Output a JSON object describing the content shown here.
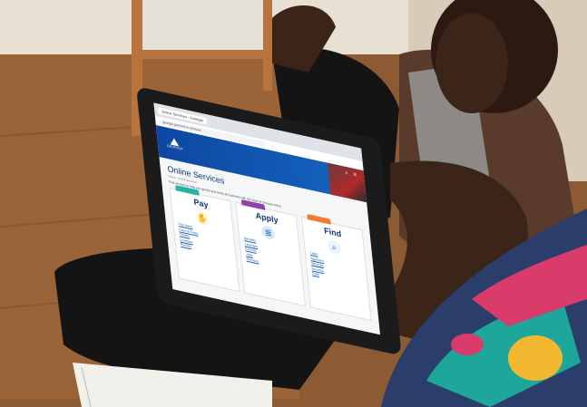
{
  "scene": {
    "colors": {
      "floor": "#8c5a33",
      "wall": "#e9e2d6",
      "skin": "#3b2418",
      "pants": "#141414",
      "tablet_frame": "#1b1b1b",
      "pillow_pink": "#d93b6b",
      "pillow_teal": "#1fa69b",
      "pillow_yellow": "#f2b930"
    }
  },
  "browser": {
    "tab_title": "Online Services - Georgia",
    "url": "georgia.gov/online-services"
  },
  "site": {
    "logo_text": "GEORGIA",
    "page_title": "Online Services",
    "breadcrumb": "Home › Online Services",
    "intro": "Find services to help you quickly and easily do business with the State of Georgia online."
  },
  "cards": [
    {
      "title": "Pay",
      "tab_color": "#26b3a4",
      "icon": "hand-payment-icon",
      "links": [
        "Pay taxes",
        "Fees & Fines",
        "Tickets",
        "Licenses",
        "Permits"
      ]
    },
    {
      "title": "Apply",
      "tab_color": "#8e44ad",
      "icon": "document-icon",
      "links": [
        "Benefits",
        "Licenses",
        "Permits",
        "Jobs",
        "Services"
      ]
    },
    {
      "title": "Find",
      "tab_color": "#f37b2b",
      "icon": "search-icon",
      "links": [
        "Laws",
        "Agencies",
        "Services",
        "Records",
        "Data"
      ]
    }
  ]
}
